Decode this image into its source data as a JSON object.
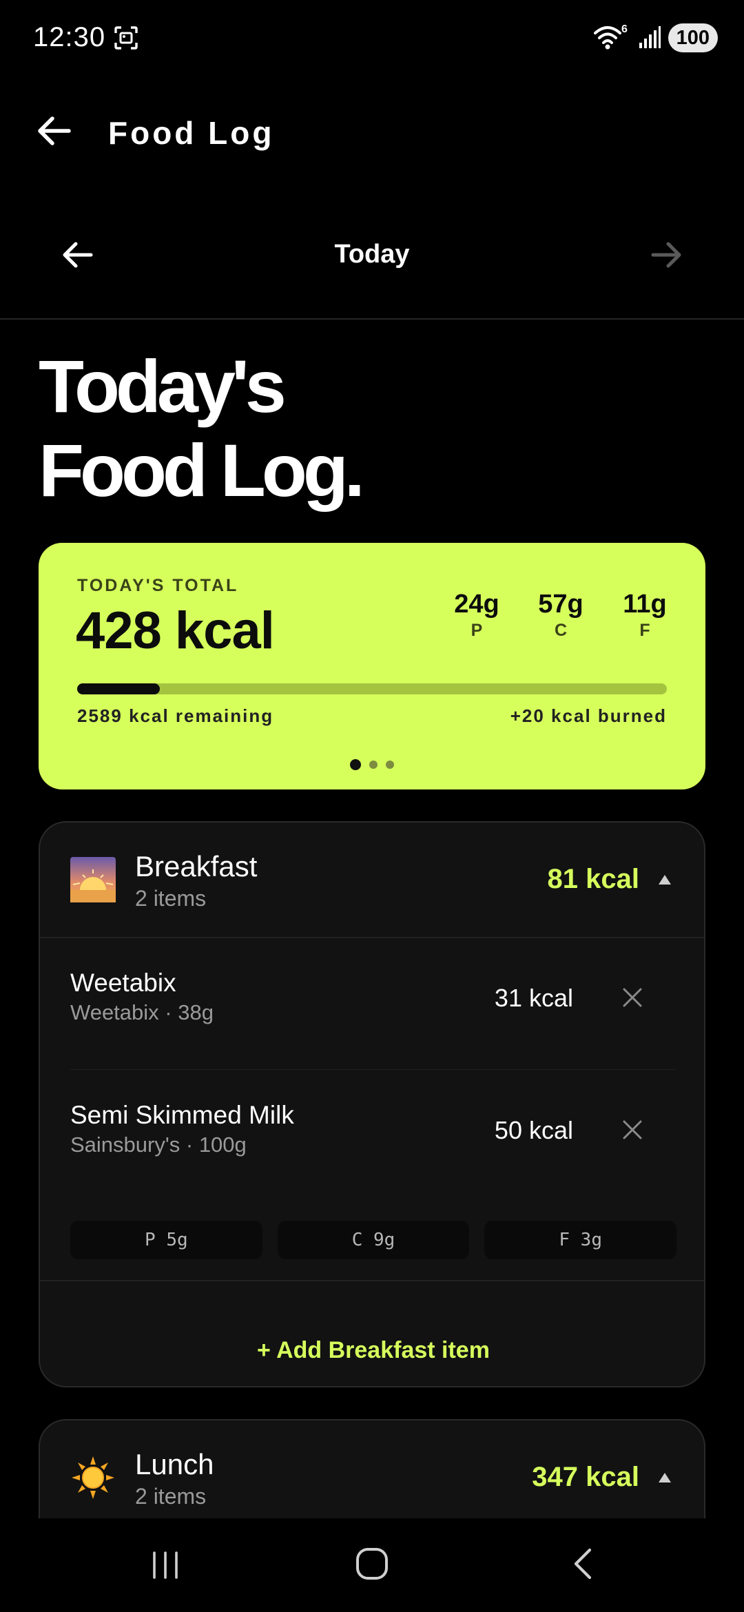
{
  "status_bar": {
    "time": "12:30",
    "wifi_label": "6",
    "battery": "100"
  },
  "appbar": {
    "title": "Food Log"
  },
  "date_nav": {
    "label": "Today"
  },
  "heading": {
    "line1": "Today's",
    "line2": "Food Log."
  },
  "total_card": {
    "label": "TODAY'S TOTAL",
    "kcal": "428 kcal",
    "macros": [
      {
        "value": "24g",
        "label": "P"
      },
      {
        "value": "57g",
        "label": "C"
      },
      {
        "value": "11g",
        "label": "F"
      }
    ],
    "progress_fraction": 0.14,
    "remaining": "2589 kcal remaining",
    "burned": "+20 kcal burned",
    "page_count": 3,
    "active_page": 1,
    "accent_color": "#d6ff5c"
  },
  "breakfast": {
    "name": "Breakfast",
    "count": "2 items",
    "kcal": "81 kcal",
    "icon": "sunrise-icon",
    "items": [
      {
        "name": "Weetabix",
        "detail": "Weetabix · 38g",
        "kcal": "31 kcal"
      },
      {
        "name": "Semi Skimmed Milk",
        "detail": "Sainsbury's · 100g",
        "kcal": "50 kcal"
      }
    ],
    "macros": {
      "p": "P  5g",
      "c": "C  9g",
      "f": "F  3g"
    },
    "add_label": "+ Add Breakfast item"
  },
  "lunch": {
    "name": "Lunch",
    "count": "2 items",
    "kcal": "347 kcal",
    "icon": "sun-icon"
  },
  "icons": {
    "back": "arrow-left-icon",
    "prev_day": "arrow-left-icon",
    "next_day": "arrow-right-icon",
    "collapse": "triangle-up-icon",
    "remove": "close-icon"
  }
}
